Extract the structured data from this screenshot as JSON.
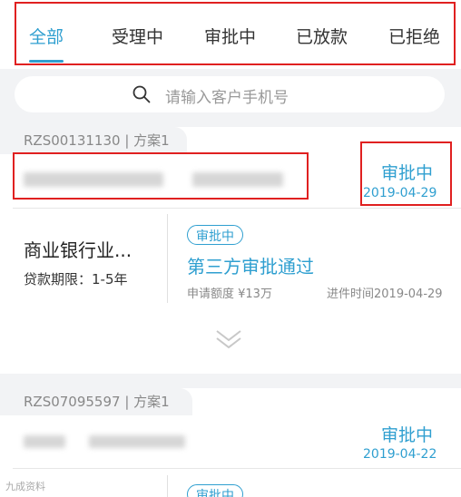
{
  "tabs": [
    {
      "label": "全部",
      "active": true
    },
    {
      "label": "受理中",
      "active": false
    },
    {
      "label": "审批中",
      "active": false
    },
    {
      "label": "已放款",
      "active": false
    },
    {
      "label": "已拒绝",
      "active": false
    }
  ],
  "search": {
    "placeholder": "请输入客户手机号"
  },
  "cards": [
    {
      "ref": "RZS00131130 | 方案1",
      "status": "审批中",
      "date": "2019-04-29",
      "product": "商业银行业...",
      "term": "贷款期限：1-5年",
      "badge": "审批中",
      "stage": "第三方审批通过",
      "amount": "申请额度 ¥13万",
      "progress_time": "进件时间2019-04-29"
    },
    {
      "ref": "RZS07095597 | 方案1",
      "status": "审批中",
      "date": "2019-04-22",
      "badge": "审批中"
    }
  ],
  "watermark": "九成资料",
  "colors": {
    "accent": "#2f9fd0",
    "highlight": "#e02020"
  }
}
